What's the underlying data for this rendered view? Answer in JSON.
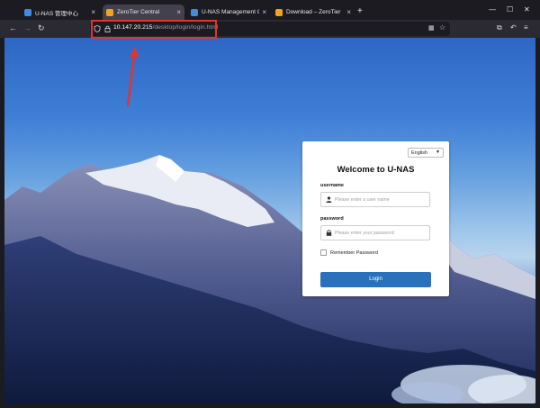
{
  "browser": {
    "tabs": [
      {
        "title": "U-NAS 管理中心",
        "favicon_color": "#3d8ee0",
        "active": false
      },
      {
        "title": "ZeroTier Central",
        "favicon_color": "#f7a21c",
        "active": true
      },
      {
        "title": "U-NAS Management Center",
        "favicon_color": "#3d8ee0",
        "active": false
      },
      {
        "title": "Download – ZeroTier",
        "favicon_color": "#f7a21c",
        "active": false
      }
    ],
    "url_host": "10.147.20.215",
    "url_path": "/desktop/login/login.html"
  },
  "login": {
    "language": "English",
    "title": "Welcome to U-NAS",
    "username_label": "username",
    "username_placeholder": "Please enter a user name",
    "password_label": "password",
    "password_placeholder": "Please enter your password",
    "remember_label": "Remember Password",
    "login_button": "Login"
  },
  "colors": {
    "accent": "#2a71bd",
    "annotation": "#e5322d"
  }
}
